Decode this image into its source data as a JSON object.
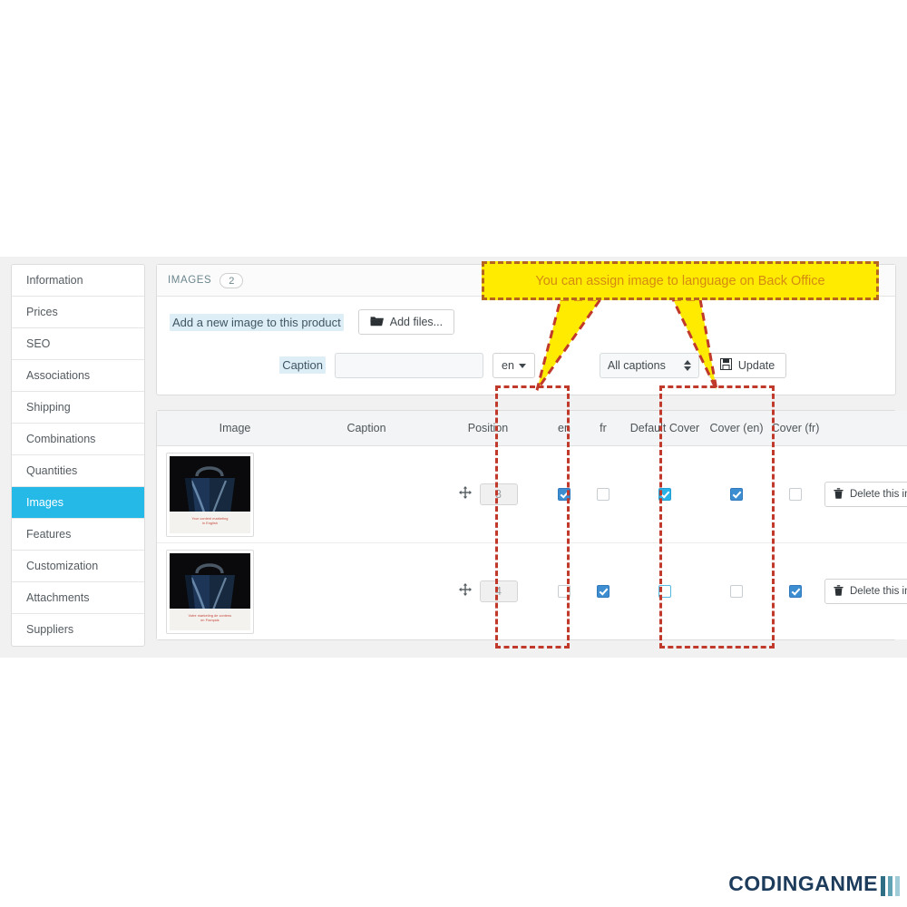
{
  "sidebar": {
    "items": [
      {
        "label": "Information",
        "active": false
      },
      {
        "label": "Prices",
        "active": false
      },
      {
        "label": "SEO",
        "active": false
      },
      {
        "label": "Associations",
        "active": false
      },
      {
        "label": "Shipping",
        "active": false
      },
      {
        "label": "Combinations",
        "active": false
      },
      {
        "label": "Quantities",
        "active": false
      },
      {
        "label": "Images",
        "active": true
      },
      {
        "label": "Features",
        "active": false
      },
      {
        "label": "Customization",
        "active": false
      },
      {
        "label": "Attachments",
        "active": false
      },
      {
        "label": "Suppliers",
        "active": false
      }
    ]
  },
  "panel": {
    "title": "IMAGES",
    "count": "2"
  },
  "upload": {
    "label": "Add a new image to this product",
    "add_files_label": "Add files...",
    "folder_icon": "folder-icon"
  },
  "caption_bar": {
    "label": "Caption",
    "input_value": "",
    "input_placeholder": "",
    "language_value": "en",
    "caption_filter_value": "All captions",
    "caption_filter_options": [
      "All captions"
    ],
    "update_label": "Update",
    "save_icon": "save-icon"
  },
  "table": {
    "headers": {
      "image": "Image",
      "caption": "Caption",
      "position": "Position",
      "en": "en",
      "fr": "fr",
      "default_cover": "Default Cover",
      "cover_en": "Cover (en)",
      "cover_fr": "Cover (fr)",
      "actions": ""
    },
    "rows": [
      {
        "thumb_caption_line1": "Your content marketing",
        "thumb_caption_line2": "in English",
        "caption": "",
        "position": "3",
        "en": true,
        "fr": false,
        "default_cover": true,
        "cover_en": true,
        "cover_fr": false,
        "delete_label": "Delete this image",
        "trash_icon": "trash-icon",
        "move_icon": "move-handle-icon"
      },
      {
        "thumb_caption_line1": "Votre marketing de contenu",
        "thumb_caption_line2": "en Français",
        "caption": "",
        "position": "4",
        "en": false,
        "fr": true,
        "default_cover": false,
        "cover_en": false,
        "cover_fr": true,
        "delete_label": "Delete this image",
        "trash_icon": "trash-icon",
        "move_icon": "move-handle-icon"
      }
    ]
  },
  "annotation": {
    "callout_text": "You can assign image to language on Back Office",
    "callout_bg": "#ffeb00",
    "callout_border": "#b5651d",
    "callout_text_color": "#d58a12",
    "rect_color": "#c0392b",
    "rect_language_label": "language-columns-highlight",
    "rect_cover_label": "cover-columns-highlight"
  },
  "watermark": {
    "text": "CODINGANME",
    "bar_colors": [
      "#2f6f85",
      "#5fa3b5",
      "#9fccd6"
    ],
    "text_color": "#1d3c5c"
  },
  "colors": {
    "accent": "#25b9e8",
    "checkbox_blue": "#3d8ed0",
    "panel_bg": "#f1f1f1"
  }
}
